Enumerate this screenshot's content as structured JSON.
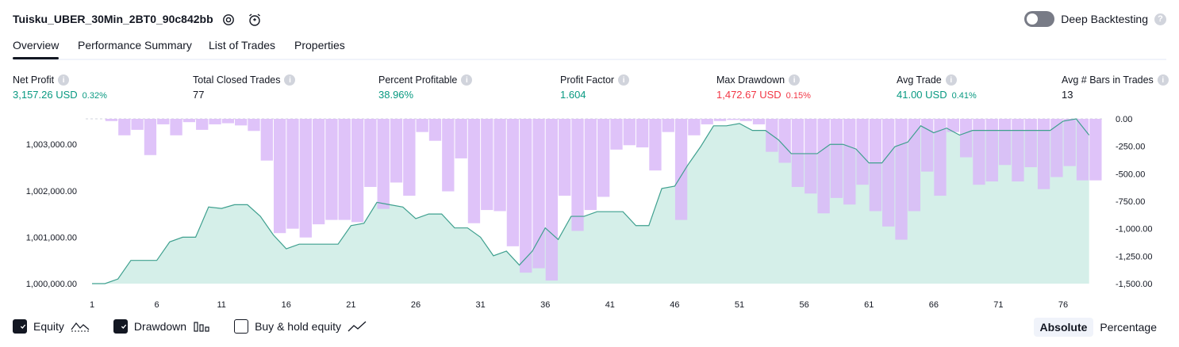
{
  "header": {
    "strategy_name": "Tuisku_UBER_30Min_2BT0_90c842bb",
    "deep_backtesting_label": "Deep Backtesting",
    "deep_backtesting_on": false
  },
  "tabs": [
    {
      "label": "Overview",
      "active": true
    },
    {
      "label": "Performance Summary",
      "active": false
    },
    {
      "label": "List of Trades",
      "active": false
    },
    {
      "label": "Properties",
      "active": false
    }
  ],
  "metrics": {
    "net_profit": {
      "label": "Net Profit",
      "value": "3,157.26 USD",
      "pct": "0.32%"
    },
    "total_closed_trades": {
      "label": "Total Closed Trades",
      "value": "77"
    },
    "percent_profitable": {
      "label": "Percent Profitable",
      "value": "38.96%"
    },
    "profit_factor": {
      "label": "Profit Factor",
      "value": "1.604"
    },
    "max_drawdown": {
      "label": "Max Drawdown",
      "value": "1,472.67 USD",
      "pct": "0.15%"
    },
    "avg_trade": {
      "label": "Avg Trade",
      "value": "41.00 USD",
      "pct": "0.41%"
    },
    "avg_bars": {
      "label": "Avg # Bars in Trades",
      "value": "13"
    }
  },
  "colors": {
    "equity_line": "#3fa08f",
    "equity_fill": "#d5efe9",
    "drawdown_bar": "#d9b8f8",
    "positive": "#089981",
    "negative": "#f23645"
  },
  "chart_data": {
    "type": "area",
    "x": [
      1,
      2,
      3,
      4,
      5,
      6,
      7,
      8,
      9,
      10,
      11,
      12,
      13,
      14,
      15,
      16,
      17,
      18,
      19,
      20,
      21,
      22,
      23,
      24,
      25,
      26,
      27,
      28,
      29,
      30,
      31,
      32,
      33,
      34,
      35,
      36,
      37,
      38,
      39,
      40,
      41,
      42,
      43,
      44,
      45,
      46,
      47,
      48,
      49,
      50,
      51,
      52,
      53,
      54,
      55,
      56,
      57,
      58,
      59,
      60,
      61,
      62,
      63,
      64,
      65,
      66,
      67,
      68,
      69,
      70,
      71,
      72,
      73,
      74,
      75,
      76,
      77,
      78
    ],
    "x_ticks": [
      "1",
      "6",
      "11",
      "16",
      "21",
      "26",
      "31",
      "36",
      "41",
      "46",
      "51",
      "56",
      "61",
      "66",
      "71",
      "76"
    ],
    "left_axis": {
      "ticks": [
        "1,000,000.00",
        "1,001,000.00",
        "1,002,000.00",
        "1,003,000.00"
      ],
      "ylim": [
        1000000,
        1003550
      ]
    },
    "right_axis": {
      "ticks": [
        "0.00",
        "-250.00",
        "-500.00",
        "-750.00",
        "-1,000.00",
        "-1,250.00",
        "-1,500.00"
      ],
      "ylim": [
        -1500,
        0
      ]
    },
    "series": [
      {
        "name": "Equity",
        "axis": "left",
        "values": [
          1000000,
          1000000,
          1000100,
          1000500,
          1000500,
          1000500,
          1000900,
          1001000,
          1001000,
          1001650,
          1001620,
          1001700,
          1001700,
          1001450,
          1001050,
          1000750,
          1000850,
          1000850,
          1000850,
          1000850,
          1001250,
          1001300,
          1001750,
          1001700,
          1001650,
          1001400,
          1001500,
          1001500,
          1001200,
          1001200,
          1001000,
          1000600,
          1000700,
          1000400,
          1000700,
          1001200,
          1000950,
          1001450,
          1001450,
          1001550,
          1001550,
          1001550,
          1001250,
          1001250,
          1002050,
          1002100,
          1002550,
          1002950,
          1003400,
          1003400,
          1003450,
          1003300,
          1003300,
          1003100,
          1002800,
          1002800,
          1002800,
          1003000,
          1003000,
          1002900,
          1002600,
          1002600,
          1002950,
          1003050,
          1003400,
          1003250,
          1003350,
          1003200,
          1003300,
          1003300,
          1003300,
          1003300,
          1003300,
          1003300,
          1003300,
          1003500,
          1003550,
          1003200
        ]
      },
      {
        "name": "Drawdown",
        "axis": "right",
        "values": [
          0,
          -20,
          -150,
          -100,
          -330,
          -50,
          -150,
          -30,
          -100,
          -50,
          -40,
          -60,
          -110,
          -380,
          -1040,
          -1000,
          -1080,
          -960,
          -920,
          -920,
          -940,
          -620,
          -820,
          -580,
          -700,
          -120,
          -200,
          -660,
          -360,
          -950,
          -830,
          -840,
          -1160,
          -1400,
          -1360,
          -1472,
          -700,
          -1020,
          -830,
          -710,
          -280,
          -240,
          -260,
          -470,
          -120,
          -920,
          -150,
          -50,
          -20,
          -10,
          -20,
          -50,
          -300,
          -400,
          -620,
          -680,
          -860,
          -720,
          -780,
          -600,
          -840,
          -980,
          -1100,
          -840,
          -480,
          -700,
          -120,
          -350,
          -600,
          -570,
          -420,
          -570,
          -440,
          -640,
          -530,
          -430,
          -560,
          -560
        ]
      }
    ]
  },
  "legend": {
    "equity": {
      "label": "Equity",
      "checked": true
    },
    "drawdown": {
      "label": "Drawdown",
      "checked": true
    },
    "buy_hold": {
      "label": "Buy & hold equity",
      "checked": false
    }
  },
  "view_mode": {
    "absolute": "Absolute",
    "percentage": "Percentage",
    "active": "absolute"
  }
}
